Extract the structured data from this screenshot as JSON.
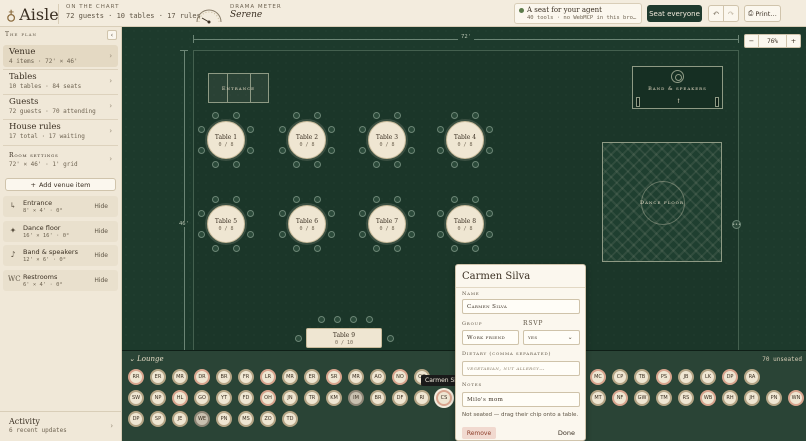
{
  "app": {
    "name": "Aisle",
    "logo_icon": "rings-icon"
  },
  "topbar": {
    "chart_caption": "On the chart",
    "chart_summary": "72 guests · 10 tables · 17 rules",
    "drama_caption": "Drama meter",
    "drama_value": "Serene",
    "agent_title": "A seat for your agent",
    "agent_sub": "40 tools · no WebMCP in this bro…",
    "seat_everyone": "Seat everyone",
    "undo_icon": "↶",
    "redo_icon": "↷",
    "print_label": "Print…"
  },
  "sidebar": {
    "header": "The plan",
    "collapse": "‹",
    "sections": [
      {
        "title": "Venue",
        "sub": "4 items · 72' × 46'"
      },
      {
        "title": "Tables",
        "sub": "10 tables · 84 seats"
      },
      {
        "title": "Guests",
        "sub": "72 guests · 70 attending"
      },
      {
        "title": "House rules",
        "sub": "17 total · 17 waiting"
      },
      {
        "title": "Room settings",
        "sub": "72' × 46' · 1' grid"
      }
    ],
    "add_venue": "Add venue item",
    "venue_items": [
      {
        "icon": "↳",
        "name": "Entrance",
        "dims": "8' × 4' · 0°",
        "action": "Hide"
      },
      {
        "icon": "✦",
        "name": "Dance floor",
        "dims": "16' × 16' · 0°",
        "action": "Hide"
      },
      {
        "icon": "♪",
        "name": "Band & speakers",
        "dims": "12' × 6' · 0°",
        "action": "Hide"
      },
      {
        "icon": "WC",
        "name": "Restrooms",
        "dims": "6' × 4' · 0°",
        "action": "Hide"
      }
    ],
    "activity_title": "Activity",
    "activity_sub": "6 recent updates"
  },
  "canvas": {
    "width_label": "72'",
    "height_label": "46'",
    "zoom_minus": "−",
    "zoom_value": "76%",
    "zoom_plus": "+",
    "entrance_label": "Entrance",
    "band_label": "Band & speakers",
    "dance_label": "Dance floor",
    "tables": [
      {
        "name": "Table 1",
        "count": "0 / 8"
      },
      {
        "name": "Table 2",
        "count": "0 / 8"
      },
      {
        "name": "Table 3",
        "count": "0 / 8"
      },
      {
        "name": "Table 4",
        "count": "0 / 8"
      },
      {
        "name": "Table 5",
        "count": "0 / 8"
      },
      {
        "name": "Table 6",
        "count": "0 / 8"
      },
      {
        "name": "Table 7",
        "count": "0 / 8"
      },
      {
        "name": "Table 8",
        "count": "0 / 8"
      }
    ],
    "long_table": {
      "name": "Table 9",
      "count": "0 / 10"
    }
  },
  "lounge": {
    "title": "Lounge",
    "count": "70 unseated",
    "rows": [
      [
        "RR",
        "ER",
        "MR",
        "DR",
        "BR",
        "FR",
        "LR",
        "MR",
        "ER",
        "SR",
        "MR",
        "AO",
        "NO",
        "OO",
        "",
        "",
        "",
        "",
        "",
        "IO",
        "AO",
        "MC",
        "CP",
        "TB",
        "PS",
        "JB",
        "LK",
        "DP",
        "RA"
      ],
      [
        "SW",
        "NP",
        "HL",
        "GO",
        "YT",
        "FD",
        "OH",
        "JN",
        "TR",
        "KM",
        "IM",
        "BR",
        "DF",
        "RI",
        "CS",
        "",
        "",
        "",
        "",
        "",
        "",
        "MT",
        "NF",
        "GW",
        "TM",
        "RS",
        "WB",
        "RH",
        "JH",
        "PN",
        "WN"
      ],
      [
        "DP",
        "SP",
        "JE",
        "WE",
        "PN",
        "MS",
        "ZO",
        "TD"
      ]
    ],
    "tooltip": "Carmen Silva"
  },
  "guest_popover": {
    "name": "Carmen Silva",
    "name_label": "Name",
    "name_value": "Carmen Silva",
    "group_label": "Group",
    "group_value": "Work friend",
    "rsvp_label": "RSVP",
    "rsvp_value": "yes",
    "dietary_label": "Dietary (comma separated)",
    "dietary_placeholder": "vegetarian, nut allergy…",
    "notes_label": "Notes",
    "notes_value": "Milo's mom",
    "note": "Not seated — drag their chip onto a table.",
    "remove": "Remove",
    "done": "Done"
  }
}
